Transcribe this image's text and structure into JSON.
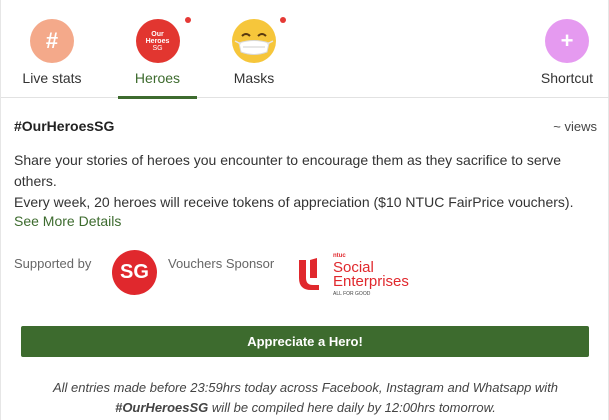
{
  "tabs": {
    "live_stats": {
      "label": "Live stats",
      "icon": "hash-icon",
      "glyph": "#",
      "color": "#f4a98a"
    },
    "heroes": {
      "label": "Heroes",
      "icon": "our-heroes-sg-logo",
      "logo_lines": [
        "Our",
        "Heroes",
        "SG"
      ],
      "color": "#e23630",
      "active": true,
      "notification": true
    },
    "masks": {
      "label": "Masks",
      "icon": "face-mask-icon",
      "color": "#f6c63b",
      "notification": true
    },
    "shortcut": {
      "label": "Shortcut",
      "icon": "plus-icon",
      "glyph": "+",
      "color": "#e59af0"
    }
  },
  "content": {
    "title": "#OurHeroesSG",
    "views": "~ views",
    "description": "Share your stories of heroes you encounter to encourage them as they sacrifice to serve others.",
    "weekly": "Every week, 20 heroes will receive tokens of appreciation ($10 NTUC FairPrice vouchers).",
    "see_more": "See More Details",
    "supported_by": "Supported by",
    "sg_logo_text": "SG",
    "vouchers_sponsor": "Vouchers Sponsor",
    "sponsor_logo": {
      "small": "ntuc",
      "line1": "Social",
      "line2": "Enterprises",
      "tagline": "ALL FOR GOOD"
    },
    "cta": "Appreciate a Hero!",
    "footnote_part1": "All entries made before 23:59hrs today across Facebook, Instagram and Whatsapp with",
    "footnote_tag": "#OurHeroesSG",
    "footnote_part2": "will be compiled here daily by 12:00hrs tomorrow."
  },
  "colors": {
    "accent": "#3d6b2e",
    "notification": "#e53935",
    "sg_red": "#e0282d"
  }
}
